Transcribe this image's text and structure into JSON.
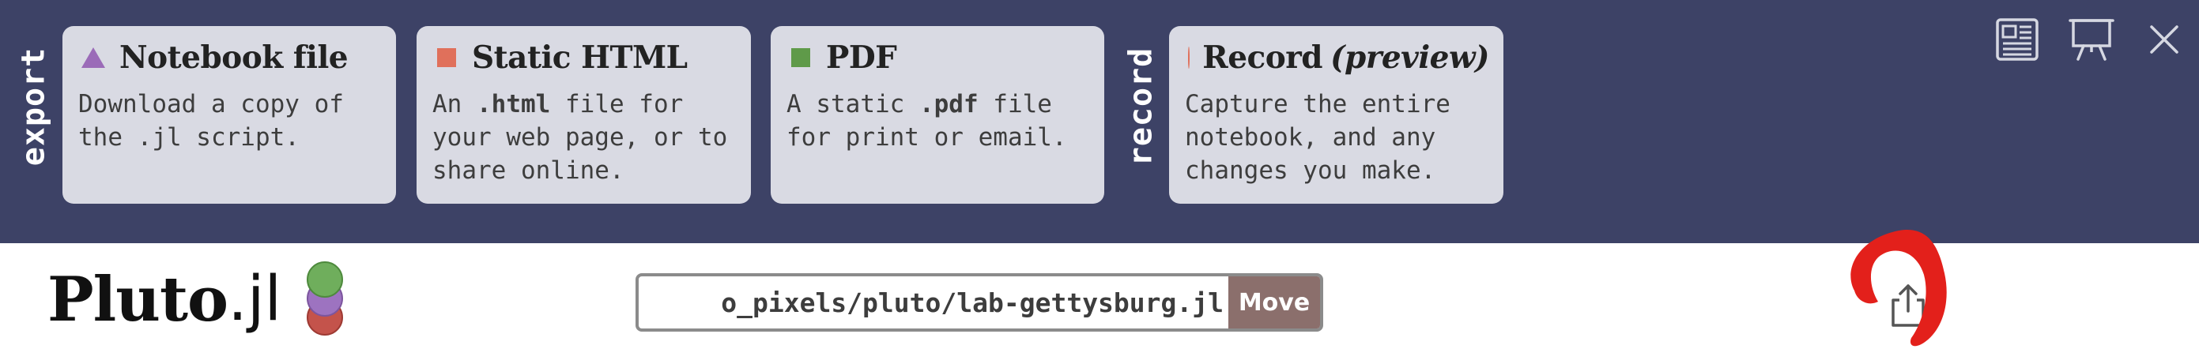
{
  "export_panel": {
    "export_label": "export",
    "record_label": "record",
    "cards": [
      {
        "title": "Notebook file",
        "desc_line1": "Download a copy of",
        "desc_line2": "the .jl script."
      },
      {
        "title": "Static HTML",
        "desc_line1_pre": "An ",
        "desc_line1_bold": ".html",
        "desc_line1_post": " file for",
        "desc_line2": "your web page, or to",
        "desc_line3": "share online."
      },
      {
        "title": "PDF",
        "desc_line1_pre": "A static ",
        "desc_line1_bold": ".pdf",
        "desc_line1_post": " file",
        "desc_line2": "for print or email."
      },
      {
        "title": "Record",
        "title_em": "(preview)",
        "desc_line1": "Capture the entire",
        "desc_line2": "notebook, and any",
        "desc_line3": "changes you make."
      }
    ],
    "icon_colors": {
      "triangle": "#9b6bb8",
      "orange": "#e0705b",
      "green": "#5f9a49"
    }
  },
  "header": {
    "logo_main": "Pluto",
    "logo_suffix": ".jl",
    "path_value": "o_pixels/pluto/lab-gettysburg.jl",
    "move_label": "Move"
  },
  "colors": {
    "panel_bg": "#3d4266",
    "card_bg": "#d9dae3",
    "move_bg": "#8b6f6c",
    "annotation": "#e3201b"
  }
}
